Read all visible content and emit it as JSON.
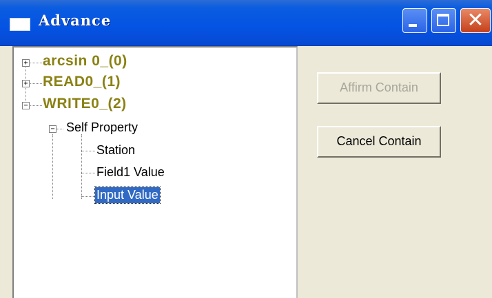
{
  "window": {
    "title": "Advance",
    "min_icon": "minimize-icon",
    "max_icon": "maximize-icon",
    "close_icon": "close-icon",
    "close_glyph": "✕"
  },
  "tree": {
    "nodes": [
      {
        "label": "arcsin 0_(0)",
        "expander": "+"
      },
      {
        "label": "READ0_(1)",
        "expander": "+"
      },
      {
        "label": "WRITE0_(2)",
        "expander": "−"
      }
    ],
    "self_property": {
      "label": "Self Property",
      "expander": "−"
    },
    "children": [
      "Station",
      "Field1 Value",
      "Input Value"
    ],
    "selected": "Input Value"
  },
  "buttons": {
    "affirm": "Affirm Contain",
    "cancel": "Cancel Contain"
  },
  "colors": {
    "title_bar": "#0553e3",
    "node_text": "#8a8113",
    "selection": "#316ac5",
    "dialog_bg": "#ece9d8"
  }
}
